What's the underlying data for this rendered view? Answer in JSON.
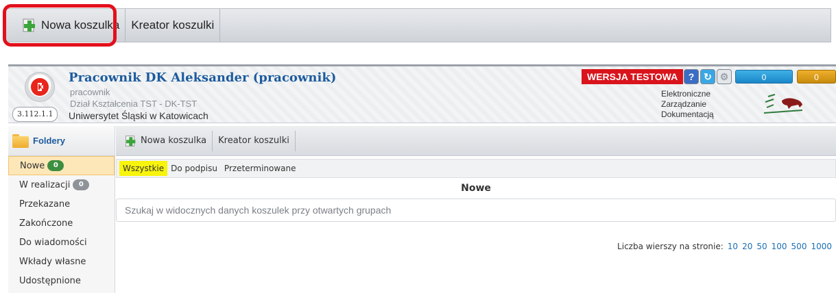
{
  "top_toolbar": {
    "new_sleeve": "Nowa koszulka",
    "sleeve_wizard": "Kreator koszulki"
  },
  "header": {
    "user_title": "Pracownik DK Aleksander (pracownik)",
    "role": "pracownik",
    "department": "Dział Kształcenia TST - DK-TST",
    "university": "Uniwersytet Śląski w Katowicach",
    "version": "3.112.1.1",
    "test_badge": "WERSJA TESTOWA",
    "counter_blue": "0",
    "counter_orange": "0",
    "ezd_line1": "Elektroniczne",
    "ezd_line2": "Zarządzanie",
    "ezd_line3": "Dokumentacją",
    "accent_color": "#1c5b9e",
    "badge_color": "#d9141c"
  },
  "sidebar": {
    "title": "Foldery",
    "items": [
      {
        "label": "Nowe",
        "count": "0"
      },
      {
        "label": "W realizacji",
        "count": "0"
      },
      {
        "label": "Przekazane"
      },
      {
        "label": "Zakończone"
      },
      {
        "label": "Do wiadomości"
      },
      {
        "label": "Wkłady własne"
      },
      {
        "label": "Udostępnione"
      }
    ]
  },
  "main": {
    "toolbar": {
      "new_sleeve": "Nowa koszulka",
      "sleeve_wizard": "Kreator koszulki"
    },
    "filters": [
      "Wszystkie",
      "Do podpisu",
      "Przeterminowane"
    ],
    "grid_title": "Nowe",
    "search_placeholder": "Szukaj w widocznych danych koszulek przy otwartych grupach",
    "pager_label": "Liczba wierszy na stronie:",
    "page_sizes": [
      "10",
      "20",
      "50",
      "100",
      "500",
      "1000"
    ]
  }
}
